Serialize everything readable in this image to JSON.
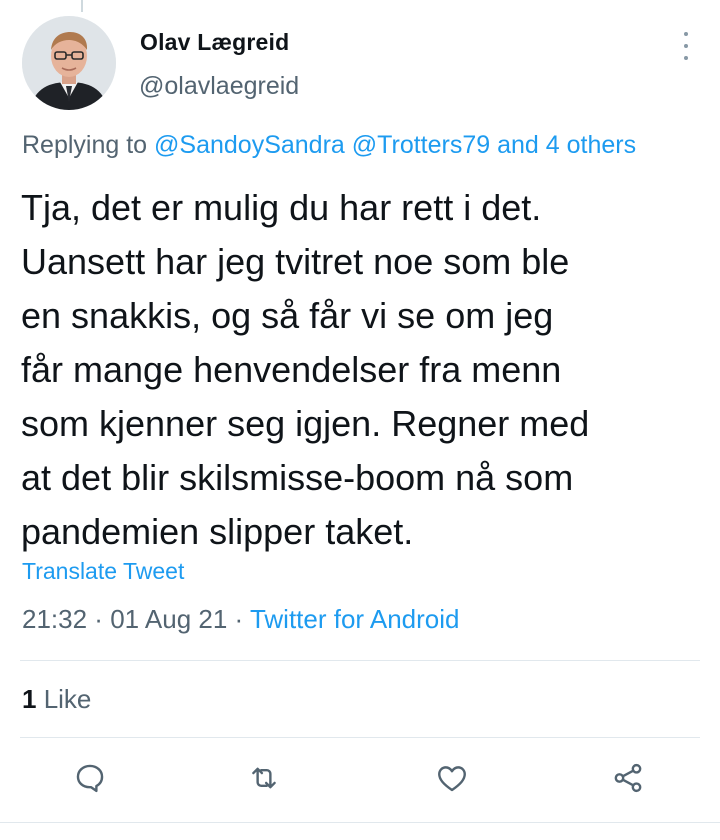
{
  "author": {
    "name": "Olav Lægreid",
    "handle": "@olavlaegreid"
  },
  "reply": {
    "prefix": "Replying to ",
    "mentions": [
      "@SandoySandra",
      "@Trotters79"
    ],
    "others": "and 4 others"
  },
  "tweet": {
    "lines": [
      "Tja, det er mulig du har rett i det.",
      "Uansett har jeg tvitret noe som ble",
      "en snakkis, og så får vi se om jeg",
      "får mange henvendelser fra menn",
      "som kjenner seg igjen. Regner med",
      "at det blir skilsmisse-boom nå som",
      "pandemien slipper taket."
    ],
    "translate_label": "Translate Tweet"
  },
  "meta": {
    "time": "21:32",
    "separator": " · ",
    "date": "01 Aug 21",
    "source": "Twitter for Android"
  },
  "stats": {
    "likes_count": "1",
    "likes_label": " Like"
  },
  "icons": {
    "reply": "reply-icon",
    "retweet": "retweet-icon",
    "like": "heart-icon",
    "share": "share-icon",
    "more": "more-vertical-icon"
  },
  "colors": {
    "accent": "#1d9bf0",
    "secondary_text": "#536471",
    "primary_text": "#0f1419"
  }
}
